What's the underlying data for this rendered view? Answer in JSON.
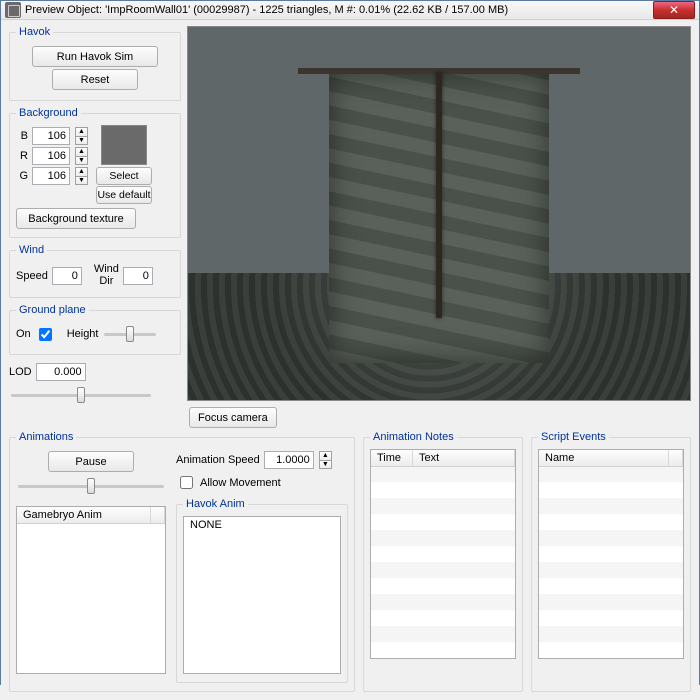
{
  "titlebar": {
    "text": "Preview Object: 'ImpRoomWall01' (00029987) - 1225 triangles, M #: 0.01% (22.62 KB / 157.00 MB)"
  },
  "havok": {
    "legend": "Havok",
    "run_label": "Run Havok Sim",
    "reset_label": "Reset"
  },
  "background": {
    "legend": "Background",
    "b_label": "B",
    "b_value": "106",
    "r_label": "R",
    "r_value": "106",
    "g_label": "G",
    "g_value": "106",
    "select_label": "Select",
    "default_label": "Use default",
    "texture_label": "Background texture"
  },
  "wind": {
    "legend": "Wind",
    "speed_label": "Speed",
    "speed_value": "0",
    "dir_label": "Wind\nDir",
    "dir_value": "0"
  },
  "ground": {
    "legend": "Ground plane",
    "on_label": "On",
    "on_checked": true,
    "height_label": "Height"
  },
  "lod": {
    "label": "LOD",
    "value": "0.000"
  },
  "focus": {
    "label": "Focus camera"
  },
  "animations": {
    "legend": "Animations",
    "pause_label": "Pause",
    "speed_label": "Animation Speed",
    "speed_value": "1.0000",
    "allow_label": "Allow Movement",
    "allow_checked": false,
    "gamebryo_header": "Gamebryo Anim",
    "havok_legend": "Havok Anim",
    "havok_value": "NONE"
  },
  "notes": {
    "legend": "Animation Notes",
    "col_time": "Time",
    "col_text": "Text"
  },
  "events": {
    "legend": "Script Events",
    "col_name": "Name"
  }
}
